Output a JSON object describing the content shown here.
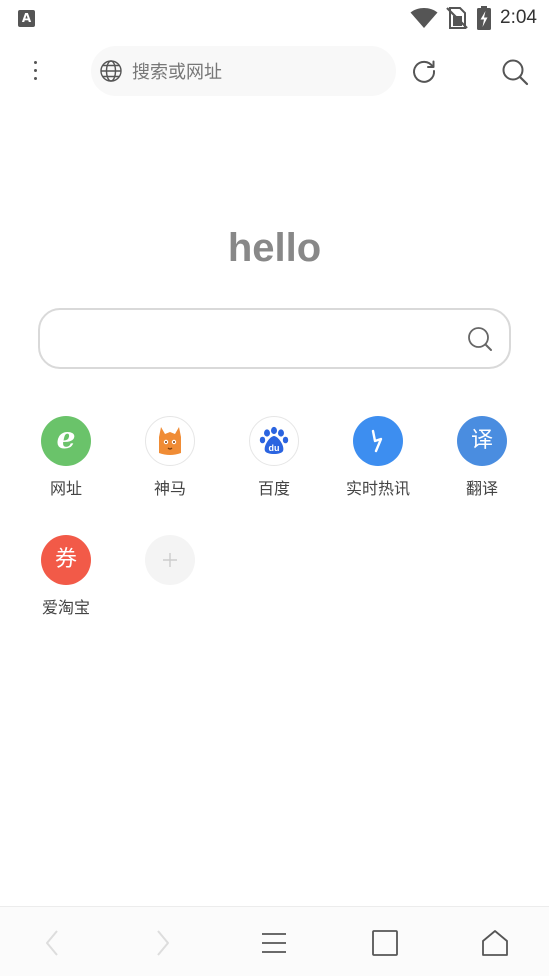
{
  "status_bar": {
    "time": "2:04",
    "notification_icon": "text-a-icon",
    "notification_glyph": "A",
    "icons": [
      "wifi-icon",
      "no-sim-icon",
      "battery-charging-icon"
    ]
  },
  "top_bar": {
    "menu_icon": "more-vertical-icon",
    "url_placeholder": "搜索或网址",
    "globe_icon": "globe-icon",
    "refresh_icon": "refresh-icon",
    "search_icon": "search-icon"
  },
  "main": {
    "title": "hello",
    "search_value": "",
    "search_icon": "search-icon"
  },
  "quick_links": [
    {
      "label": "网址",
      "icon": "green-e-icon",
      "color": "#6ac36a",
      "glyph": "e"
    },
    {
      "label": "神马",
      "icon": "alpaca-icon",
      "color": "#f08c35"
    },
    {
      "label": "百度",
      "icon": "baidu-paw-icon",
      "color": "#2b64e0",
      "glyph": "du"
    },
    {
      "label": "实时热讯",
      "icon": "lightning-icon",
      "color": "#3d8ef0"
    },
    {
      "label": "翻译",
      "icon": "translate-icon",
      "color": "#4a8de0",
      "glyph": "译"
    },
    {
      "label": "爱淘宝",
      "icon": "coupon-icon",
      "color": "#f25a48",
      "glyph": "券"
    },
    {
      "label": "",
      "icon": "plus-icon",
      "color": "#cccccc"
    }
  ],
  "bottom_nav": {
    "items": [
      "back-icon",
      "forward-icon",
      "menu-icon",
      "tabs-icon",
      "home-icon"
    ],
    "disabled_color": "#dddddd",
    "active_color": "#555555"
  }
}
